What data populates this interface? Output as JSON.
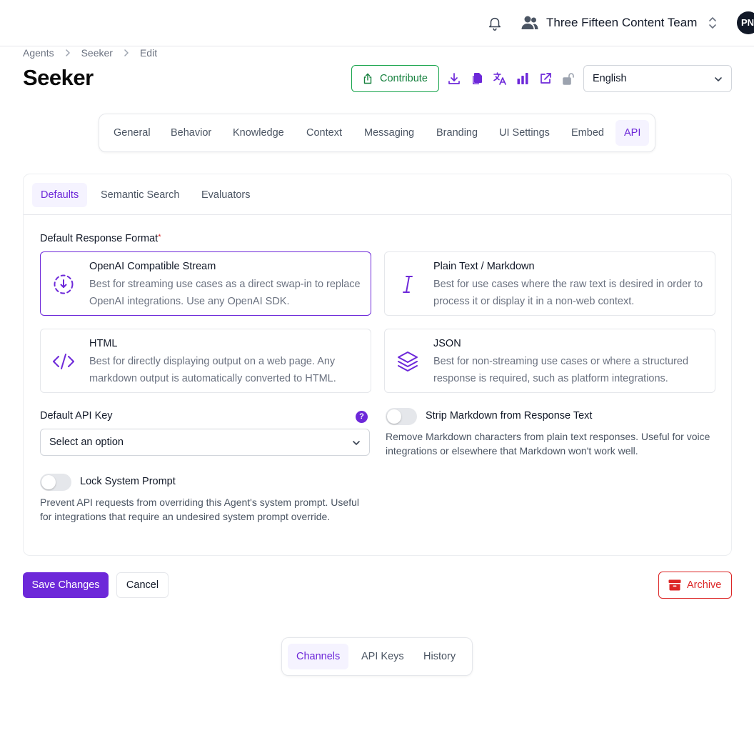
{
  "header": {
    "team_name": "Three Fifteen Content Team",
    "avatar_initials": "PN",
    "icons": [
      "bell-icon",
      "users-icon",
      "chevron-up-down-icon"
    ]
  },
  "breadcrumb": [
    "Agents",
    "Seeker",
    "Edit"
  ],
  "page_title": "Seeker",
  "actions": {
    "contribute_label": "Contribute",
    "icons": [
      "download-icon",
      "copy-icon",
      "translate-icon",
      "chart-bar-icon",
      "external-link-icon",
      "lock-open-icon"
    ],
    "language": "English"
  },
  "main_tabs": [
    "General",
    "Behavior",
    "Knowledge",
    "Context",
    "Messaging",
    "Branding",
    "UI Settings",
    "Embed",
    "API"
  ],
  "main_tab_active": "API",
  "sub_tabs": [
    "Defaults",
    "Semantic Search",
    "Evaluators"
  ],
  "sub_tab_active": "Defaults",
  "response_format": {
    "label": "Default Response Format",
    "required_mark": "*",
    "options": [
      {
        "title": "OpenAI Compatible Stream",
        "desc": "Best for streaming use cases as a direct swap-in to replace OpenAI integrations. Use any OpenAI SDK.",
        "icon": "dashed-stream-icon",
        "selected": true
      },
      {
        "title": "Plain Text / Markdown",
        "desc": "Best for use cases where the raw text is desired in order to process it or display it in a non-web context.",
        "icon": "italic-cursor-icon",
        "selected": false
      },
      {
        "title": "HTML",
        "desc": "Best for directly displaying output on a web page. Any markdown output is automatically converted to HTML.",
        "icon": "code-icon",
        "selected": false
      },
      {
        "title": "JSON",
        "desc": "Best for non-streaming use cases or where a structured response is required, such as platform integrations.",
        "icon": "layers-icon",
        "selected": false
      }
    ]
  },
  "api_key": {
    "label": "Default API Key",
    "help": "?",
    "placeholder": "Select an option"
  },
  "strip_markdown": {
    "label": "Strip Markdown from Response Text",
    "desc": "Remove Markdown characters from plain text responses. Useful for voice integrations or elsewhere that Markdown won't work well.",
    "enabled": false
  },
  "lock_prompt": {
    "label": "Lock System Prompt",
    "desc": "Prevent API requests from overriding this Agent's system prompt. Useful for integrations that require an undesired system prompt override.",
    "enabled": false
  },
  "footer": {
    "save_label": "Save Changes",
    "cancel_label": "Cancel",
    "archive_label": "Archive"
  },
  "bottom_tabs": [
    "Channels",
    "API Keys",
    "History"
  ],
  "bottom_tab_active": "Channels",
  "colors": {
    "accent": "#6d28d9",
    "success": "#16a34a",
    "danger": "#dc2626"
  }
}
